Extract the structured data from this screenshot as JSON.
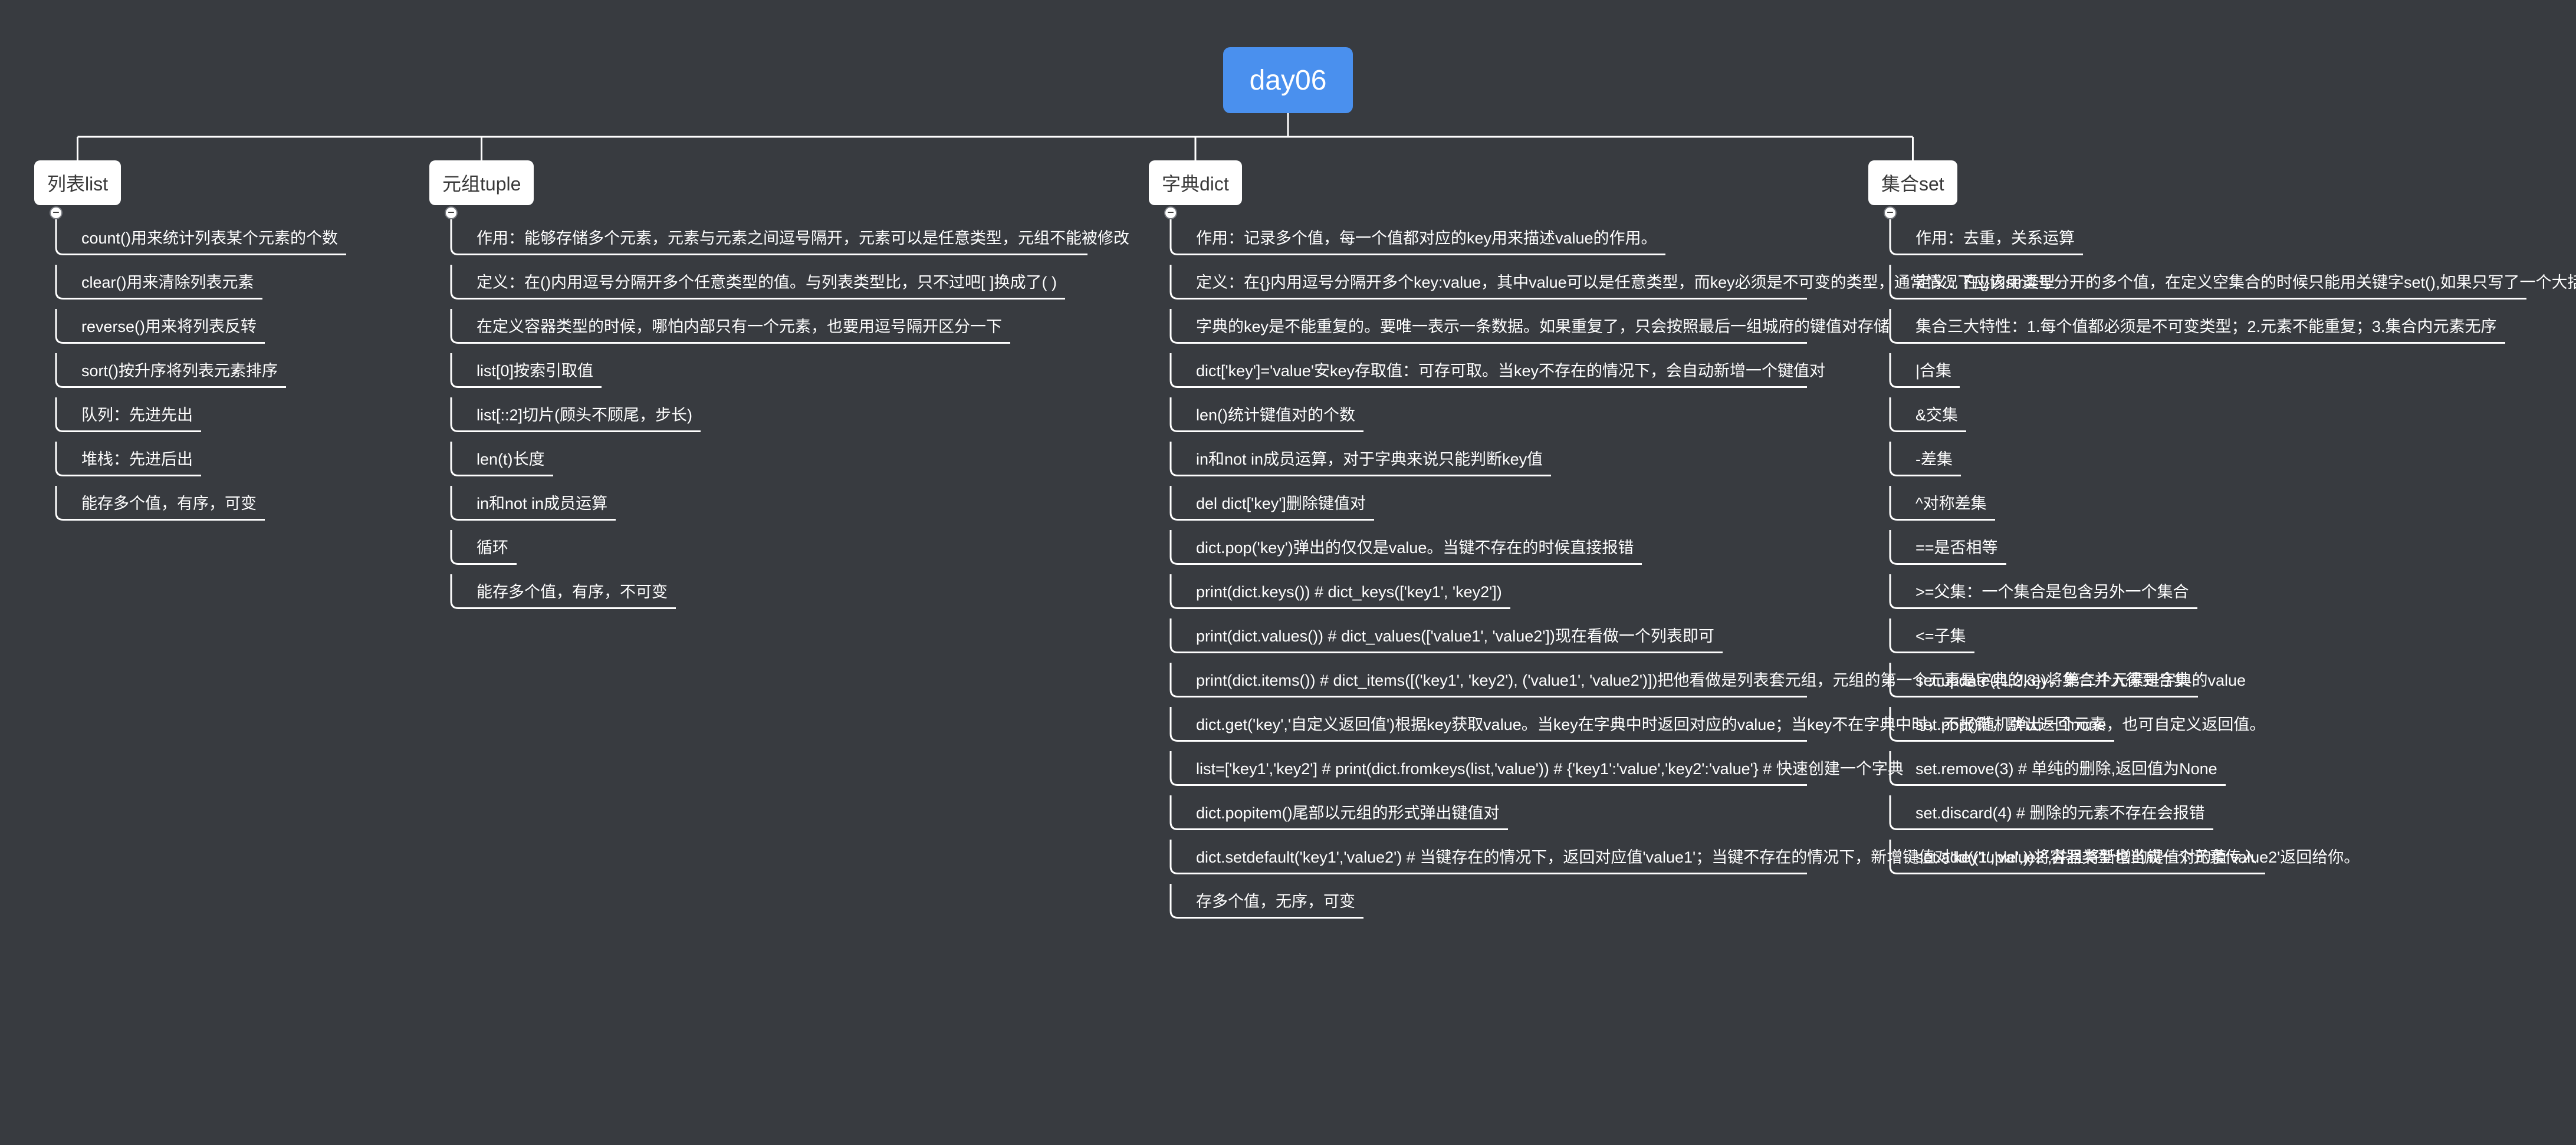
{
  "root": {
    "label": "day06"
  },
  "colors": {
    "background": "#383b40",
    "root": "#4a90ee",
    "branch_bg": "#ffffff",
    "line": "#ffffff"
  },
  "branches": [
    {
      "label": "列表list",
      "items": [
        "count()用来统计列表某个元素的个数",
        "clear()用来清除列表元素",
        "reverse()用来将列表反转",
        "sort()按升序将列表元素排序",
        "队列：先进先出",
        "堆栈：先进后出",
        "能存多个值，有序，可变"
      ]
    },
    {
      "label": "元组tuple",
      "items": [
        "作用：能够存储多个元素，元素与元素之间逗号隔开，元素可以是任意类型，元组不能被修改",
        "定义：在()内用逗号分隔开多个任意类型的值。与列表类型比，只不过吧[ ]换成了( )",
        "在定义容器类型的时候，哪怕内部只有一个元素，也要用逗号隔开区分一下",
        "list[0]按索引取值",
        "list[::2]切片(顾头不顾尾，步长)",
        "len(t)长度",
        "in和not in成员运算",
        "循环",
        "能存多个值，有序，不可变"
      ]
    },
    {
      "label": "字典dict",
      "items": [
        "作用：记录多个值，每一个值都对应的key用来描述value的作用。",
        "定义：在{}内用逗号分隔开多个key:value，其中value可以是任意类型，而key必须是不可变的类型，通常情况下应该str类型",
        "字典的key是不能重复的。要唯一表示一条数据。如果重复了，只会按照最后一组城府的键值对存储",
        "dict['key']='value'安key存取值：可存可取。当key不存在的情况下，会自动新增一个键值对",
        "len()统计键值对的个数",
        "in和not in成员运算，对于字典来说只能判断key值",
        "del dict['key']删除键值对",
        "dict.pop('key')弹出的仅仅是value。当键不存在的时候直接报错",
        "print(dict.keys())  # dict_keys(['key1', 'key2'])",
        "print(dict.values())  # dict_values(['value1', 'value2'])现在看做一个列表即可",
        "print(dict.items())  # dict_items([('key1', 'key2'), ('value1', 'value2')])把他看做是列表套元组，元组的第一个元素是字典的key，第二个元素是字典的value",
        "dict.get('key','自定义返回值')根据key获取value。当key在字典中时返回对应的value；当key不在字典中时，不报错，默认返回none，也可自定义返回值。",
        "list=['key1','key2']  # print(dict.fromkeys(list,'value'))  # {'key1':'value','key2':'value'}  # 快速创建一个字典",
        "dict.popitem()尾部以元组的形式弹出键值对",
        "dict.setdefault('key1','value2')  # 当键存在的情况下，返回对应值'value1'；当键不存在的情况下，新增键值对'key1','value2',并且将新增的键值对的值'value2'返回给你。",
        "存多个值，无序，可变"
      ]
    },
    {
      "label": "集合set",
      "items": [
        "作用：去重，关系运算",
        "定义：在{}内用逗号分开的多个值，在定义空集合的时候只能用关键字set(),如果只写了一个大括号，python默认将他当做字典类型",
        "集合三大特性：1.每个值都必须是不可变类型；2.元素不能重复；3.集合内元素无序",
        "|合集",
        "&交集",
        "-差集",
        "^对称差集",
        "==是否相等",
        ">=父集：一个集合是包含另外一个集合",
        "<=子集",
        "set.update({1,2,3})将集合并入得到合集",
        "set.pop()随机弹出一个元素",
        "set.remove(3)  # 单纯的删除,返回值为None",
        "set.discard(4)  # 删除的元素不存在会报错",
        "set.add(('tuple',))将容器类型也当成一个元素传入"
      ]
    }
  ]
}
